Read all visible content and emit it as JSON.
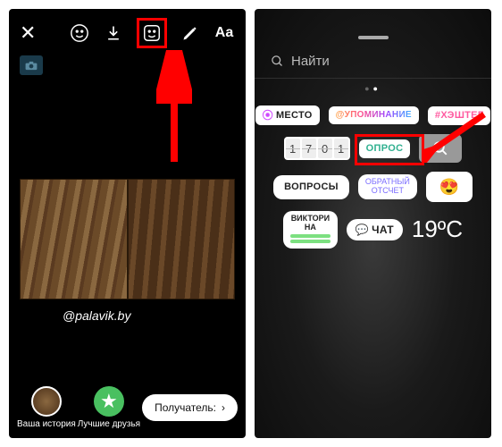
{
  "left": {
    "caption": "@palavik.by",
    "bottom": {
      "your_story": "Ваша история",
      "best_friends": "Лучшие друзья",
      "recipient": "Получатель:"
    },
    "toolbar": {
      "text_tool": "Aa"
    }
  },
  "right": {
    "search_placeholder": "Найти",
    "stickers": {
      "location": "МЕСТО",
      "mention": "@УПОМИНАНИЕ",
      "hashtag": "#ХЭШТЕГ",
      "time_digits": [
        "1",
        "7",
        "0",
        "1"
      ],
      "poll": "ОПРОС",
      "questions": "ВОПРОСЫ",
      "countdown": "ОБРАТНЫЙ\nОТСЧЕТ",
      "quiz": "ВИКТОРИ\nНА",
      "chat": "ЧАТ",
      "temperature": "19ºC"
    }
  },
  "annotations": {
    "highlight_left": "sticker-tool",
    "highlight_right": "mention-sticker"
  }
}
